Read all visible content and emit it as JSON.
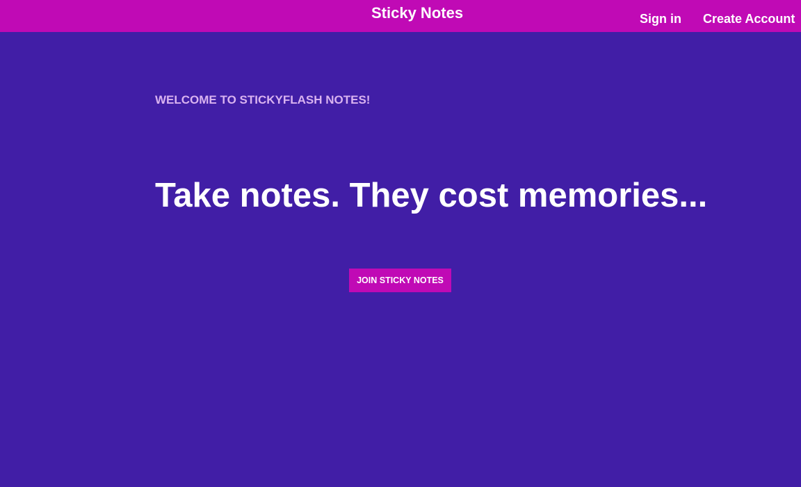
{
  "header": {
    "brand": "Sticky Notes",
    "nav": {
      "sign_in": "Sign in",
      "create_account": "Create Account"
    }
  },
  "hero": {
    "welcome": "WELCOME TO STICKYFLASH NOTES!",
    "headline": "Take notes. They cost memories...",
    "cta_label": "JOIN STICKY NOTES"
  },
  "colors": {
    "header_background": "#c00ab5",
    "page_background": "#411ea6",
    "welcome_text": "#d9b3f0",
    "button_background": "#c00ab5"
  }
}
